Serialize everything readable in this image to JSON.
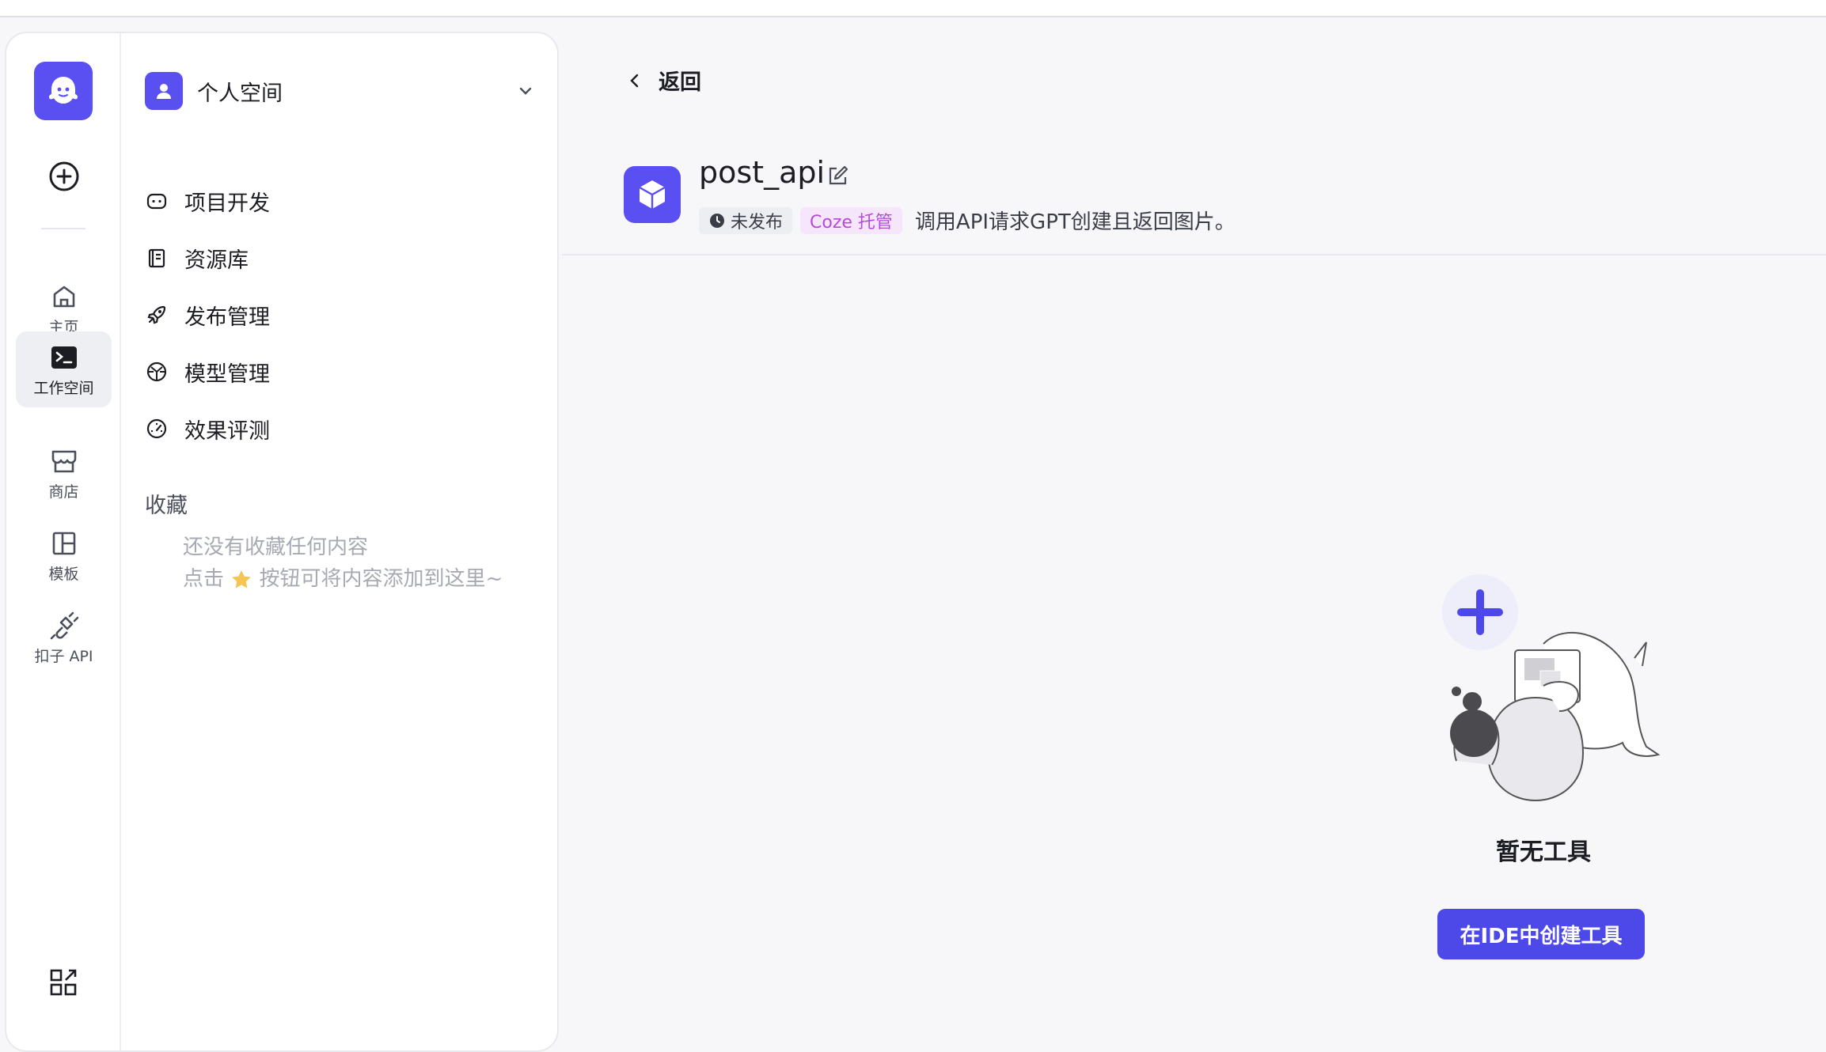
{
  "rail": {
    "items": [
      {
        "label": "主页",
        "icon": "home-icon"
      },
      {
        "label": "工作空间",
        "icon": "terminal-icon"
      },
      {
        "label": "商店",
        "icon": "store-icon"
      },
      {
        "label": "模板",
        "icon": "template-icon"
      },
      {
        "label": "扣子 API",
        "icon": "api-plug-icon"
      }
    ]
  },
  "space": {
    "name": "个人空间"
  },
  "nav": {
    "items": [
      {
        "label": "项目开发",
        "icon": "bot-icon"
      },
      {
        "label": "资源库",
        "icon": "library-icon"
      },
      {
        "label": "发布管理",
        "icon": "rocket-icon"
      },
      {
        "label": "模型管理",
        "icon": "model-icon"
      },
      {
        "label": "效果评测",
        "icon": "gauge-icon"
      }
    ],
    "favorites_title": "收藏",
    "favorites_empty_line1": "还没有收藏任何内容",
    "favorites_empty_line2_a": "点击",
    "favorites_empty_line2_b": "按钮可将内容添加到这里~"
  },
  "main": {
    "back_label": "返回",
    "tool_name": "post_api",
    "status": "未发布",
    "host_tag": "Coze 托管",
    "description": "调用API请求GPT创建且返回图片。",
    "empty_title": "暂无工具",
    "create_button": "在IDE中创建工具"
  },
  "colors": {
    "accent": "#4d49e8",
    "brand": "#5a4ff0",
    "host_tag_text": "#b54ad9"
  }
}
